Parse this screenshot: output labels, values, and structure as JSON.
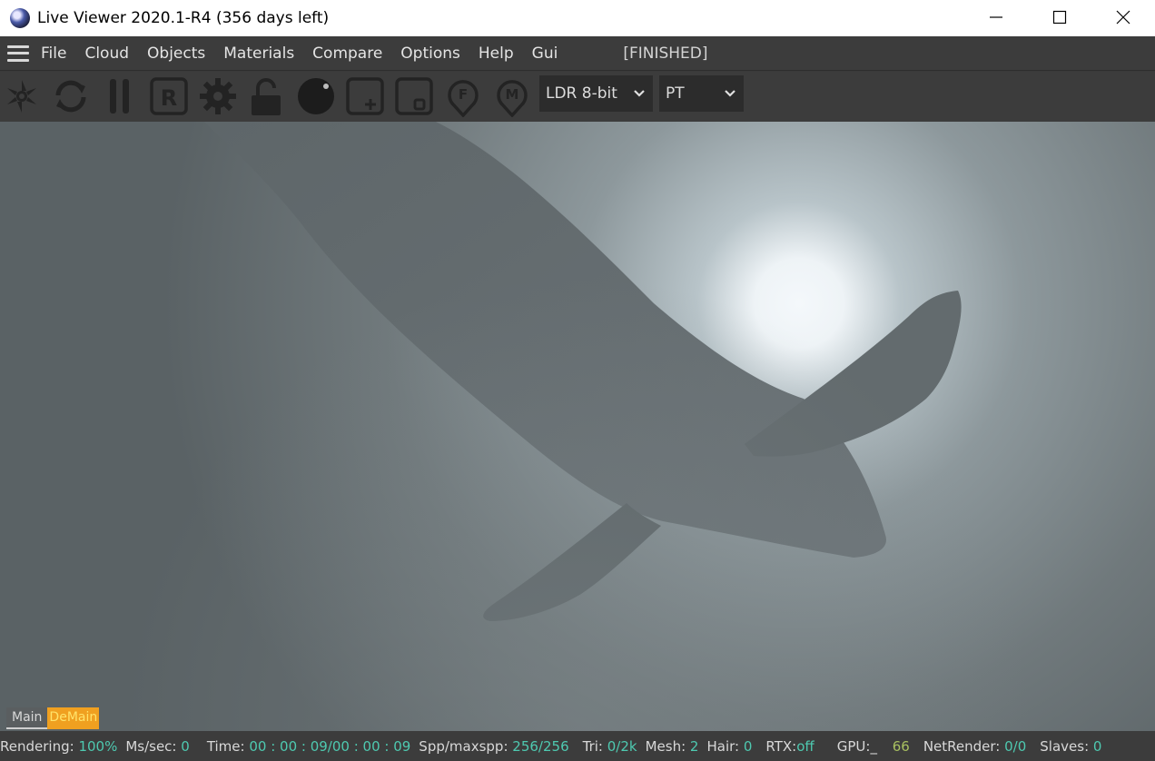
{
  "window": {
    "title": "Live Viewer 2020.1-R4 (356 days left)",
    "controls": [
      "minimize",
      "maximize",
      "close"
    ]
  },
  "menu": {
    "items": [
      "File",
      "Cloud",
      "Objects",
      "Materials",
      "Compare",
      "Options",
      "Help",
      "Gui"
    ],
    "status": "[FINISHED]"
  },
  "toolbar": {
    "icons": [
      "shutter-icon",
      "refresh-icon",
      "pause-icon",
      "region-r-icon",
      "settings-gear-icon",
      "unlock-icon",
      "material-ball-icon",
      "add-frame-icon",
      "object-frame-icon",
      "focus-pin-icon",
      "material-pin-icon"
    ],
    "display_mode": "LDR 8-bit",
    "kernel": "PT"
  },
  "viewport": {
    "tabs": [
      "Main",
      "DeMain"
    ]
  },
  "status": {
    "rendering_label": "Rendering:",
    "rendering_value": "100%",
    "ms_label": "Ms/sec:",
    "ms_value": "0",
    "time_label": "Time:",
    "time_value": "00 : 00 : 09/00 : 00 : 09",
    "spp_label": "Spp/maxspp:",
    "spp_value": "256/256",
    "tri_label": "Tri:",
    "tri_value": "0/2k",
    "mesh_label": "Mesh:",
    "mesh_value": "2",
    "hair_label": "Hair:",
    "hair_value": "0",
    "rtx_label": "RTX:",
    "rtx_value": "off",
    "gpu_label": "GPU:",
    "gpu_sep": "_",
    "gpu_value": "66",
    "netrender_label": "NetRender:",
    "netrender_value": "0/0",
    "slaves_label": "Slaves:",
    "slaves_value": "0"
  },
  "colors": {
    "chrome": "#3c3c3c",
    "value_cyan": "#4ec9b0",
    "value_green": "#a8c060",
    "tab_accent": "#f0a020"
  }
}
